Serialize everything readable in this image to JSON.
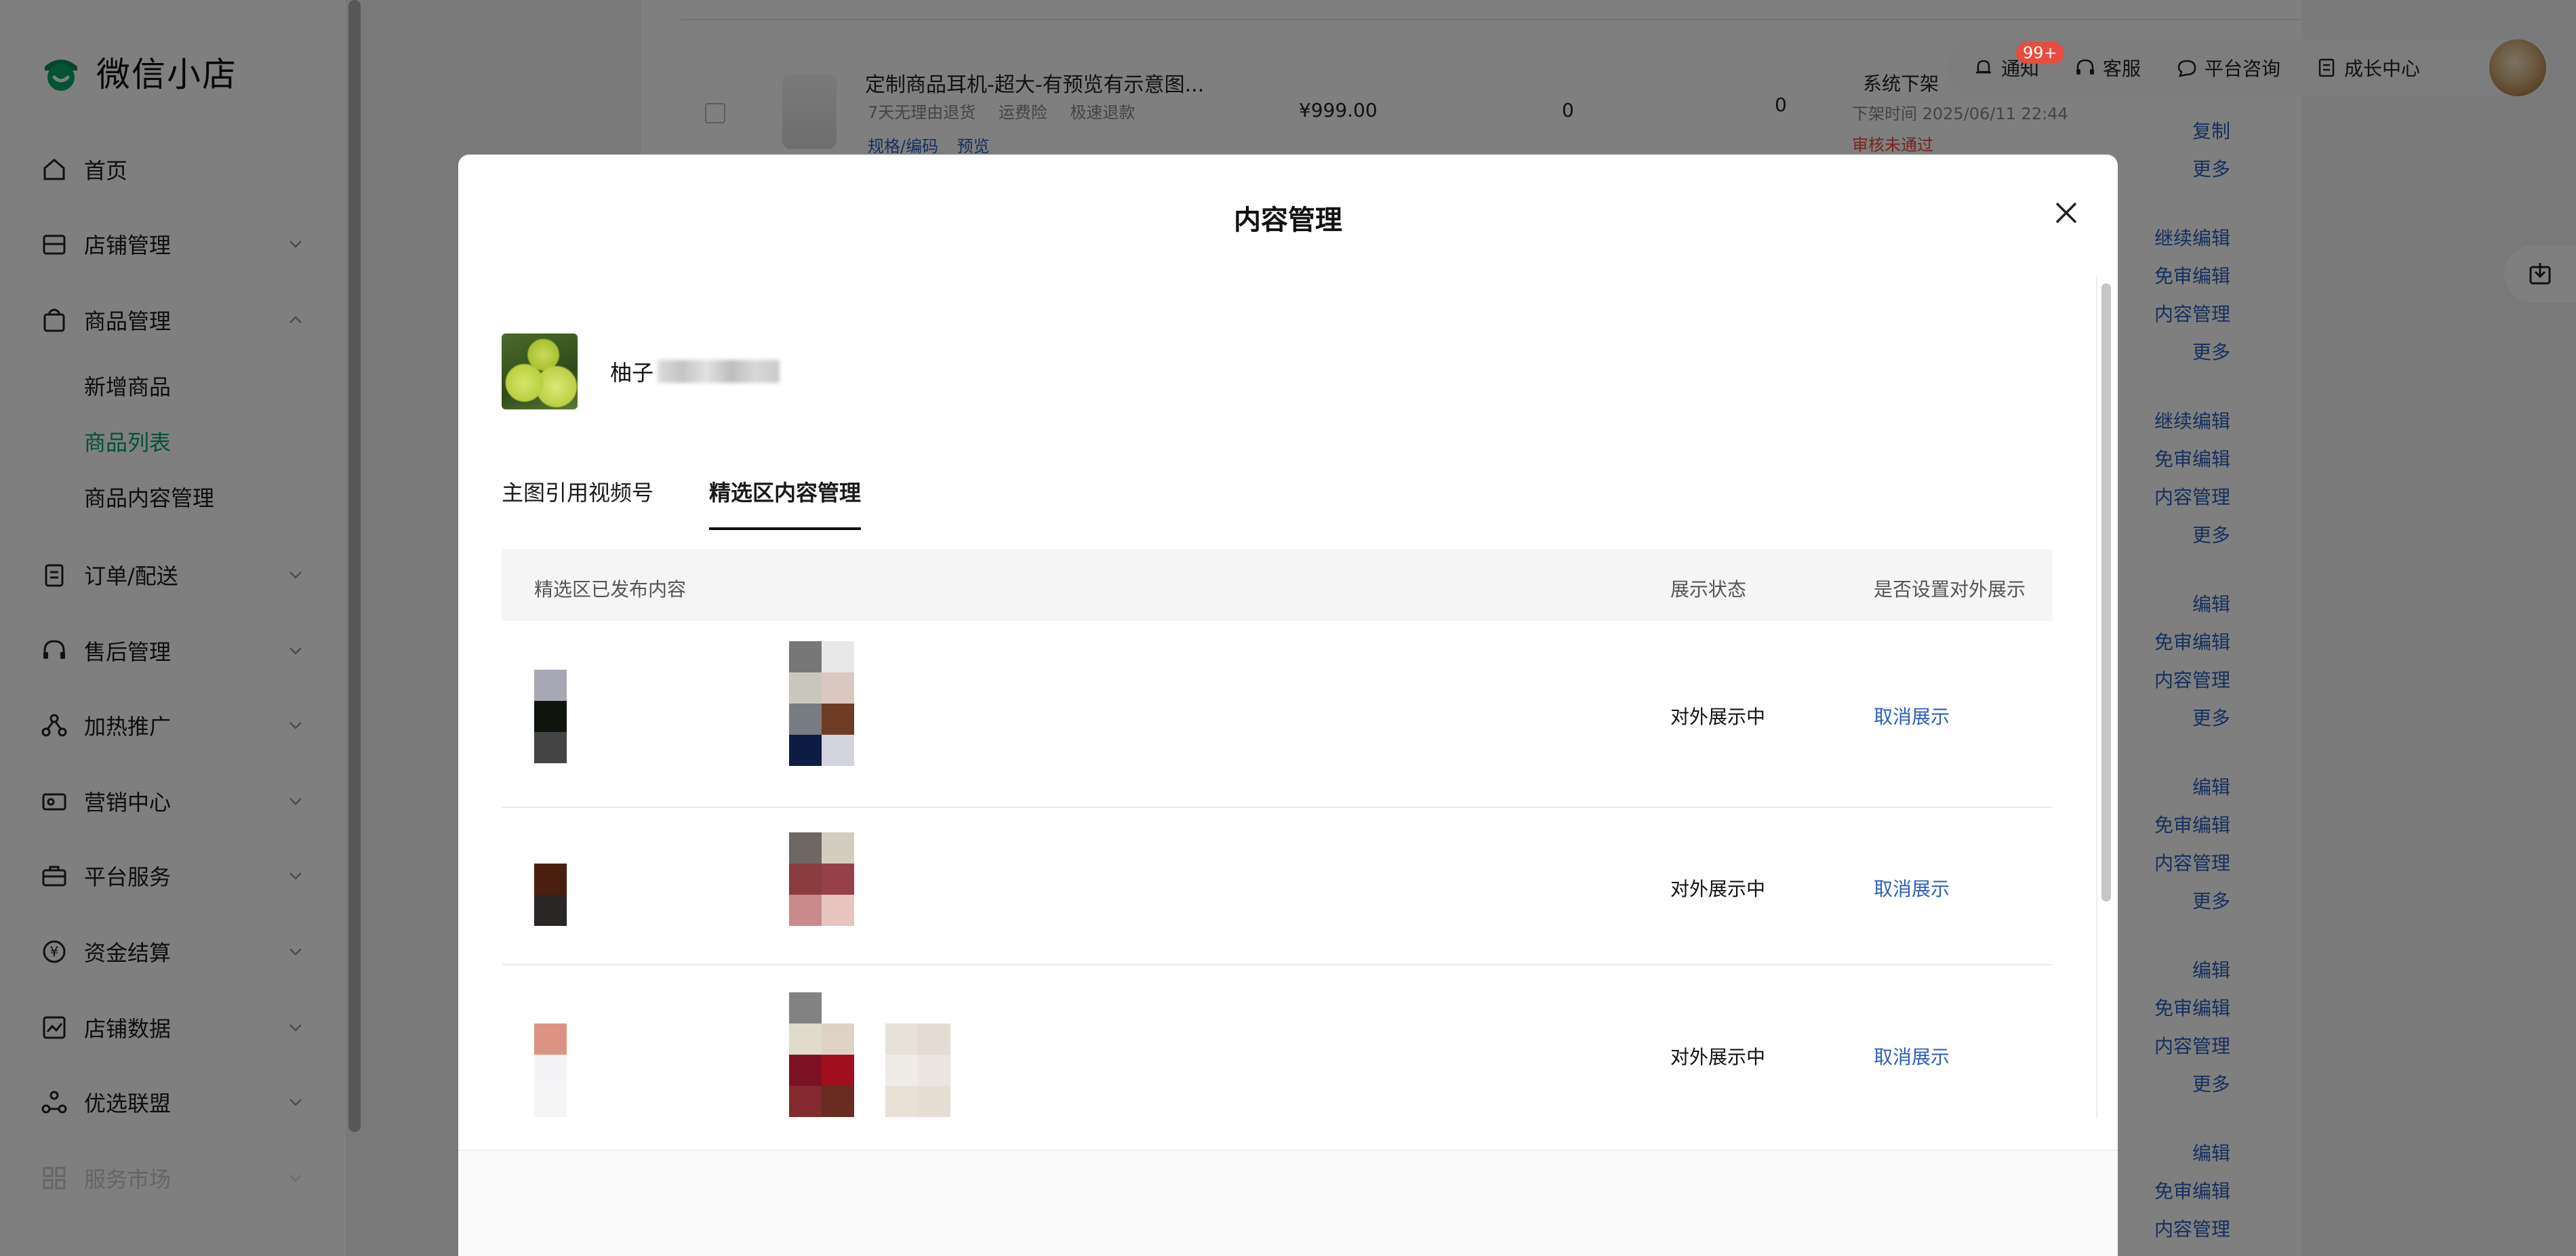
{
  "app": {
    "logo_text": "微信小店"
  },
  "sidebar": {
    "items": [
      {
        "label": "首页",
        "icon": "home-icon"
      },
      {
        "label": "店铺管理",
        "icon": "store-icon"
      },
      {
        "label": "商品管理",
        "icon": "bag-icon"
      },
      {
        "label": "订单/配送",
        "icon": "clipboard-icon"
      },
      {
        "label": "售后管理",
        "icon": "headset-icon"
      },
      {
        "label": "加热推广",
        "icon": "share-nodes-icon"
      },
      {
        "label": "营销中心",
        "icon": "ticket-icon"
      },
      {
        "label": "平台服务",
        "icon": "briefcase-icon"
      },
      {
        "label": "资金结算",
        "icon": "yen-circle-icon"
      },
      {
        "label": "店铺数据",
        "icon": "chart-icon"
      },
      {
        "label": "优选联盟",
        "icon": "alliance-icon"
      },
      {
        "label": "服务市场",
        "icon": "grid-icon"
      }
    ],
    "sub_items": [
      {
        "label": "新增商品"
      },
      {
        "label": "商品列表"
      },
      {
        "label": "商品内容管理"
      }
    ]
  },
  "topbar": {
    "notify_label": "通知",
    "notify_badge": "99+",
    "service_label": "客服",
    "consult_label": "平台咨询",
    "growth_label": "成长中心"
  },
  "product_row": {
    "title": "定制商品耳机-超大-有预览有示意图...",
    "tag1": "7天无理由退货",
    "tag2": "运费险",
    "tag3": "极速退款",
    "link1": "规格/编码",
    "link2": "预览",
    "price": "¥999.00",
    "stock": "0",
    "sales": "0",
    "status": "系统下架",
    "time": "下架时间 2025/06/11 22:44",
    "audit": "审核未通过"
  },
  "row_ops": {
    "r1": [
      "复制",
      "更多"
    ],
    "r2": [
      "继续编辑",
      "免审编辑",
      "内容管理",
      "更多"
    ],
    "r3": [
      "继续编辑",
      "免审编辑",
      "内容管理",
      "更多"
    ],
    "r4": [
      "编辑",
      "免审编辑",
      "内容管理",
      "更多"
    ],
    "r5": [
      "编辑",
      "免审编辑",
      "内容管理",
      "更多"
    ],
    "r6": [
      "编辑",
      "免审编辑",
      "内容管理",
      "更多"
    ],
    "r7": [
      "编辑",
      "免审编辑",
      "内容管理"
    ]
  },
  "modal": {
    "title": "内容管理",
    "goods_name": "柚子",
    "tabs": [
      {
        "label": "主图引用视频号"
      },
      {
        "label": "精选区内容管理"
      }
    ],
    "table": {
      "headers": {
        "content": "精选区已发布内容",
        "status": "展示状态",
        "setting": "是否设置对外展示"
      },
      "rows": [
        {
          "status": "对外展示中",
          "action": "取消展示"
        },
        {
          "status": "对外展示中",
          "action": "取消展示"
        },
        {
          "status": "对外展示中",
          "action": "取消展示"
        }
      ]
    }
  },
  "colors": {
    "brand": "#07a66a",
    "link": "#2b5fbd",
    "danger": "#e84c3d"
  }
}
